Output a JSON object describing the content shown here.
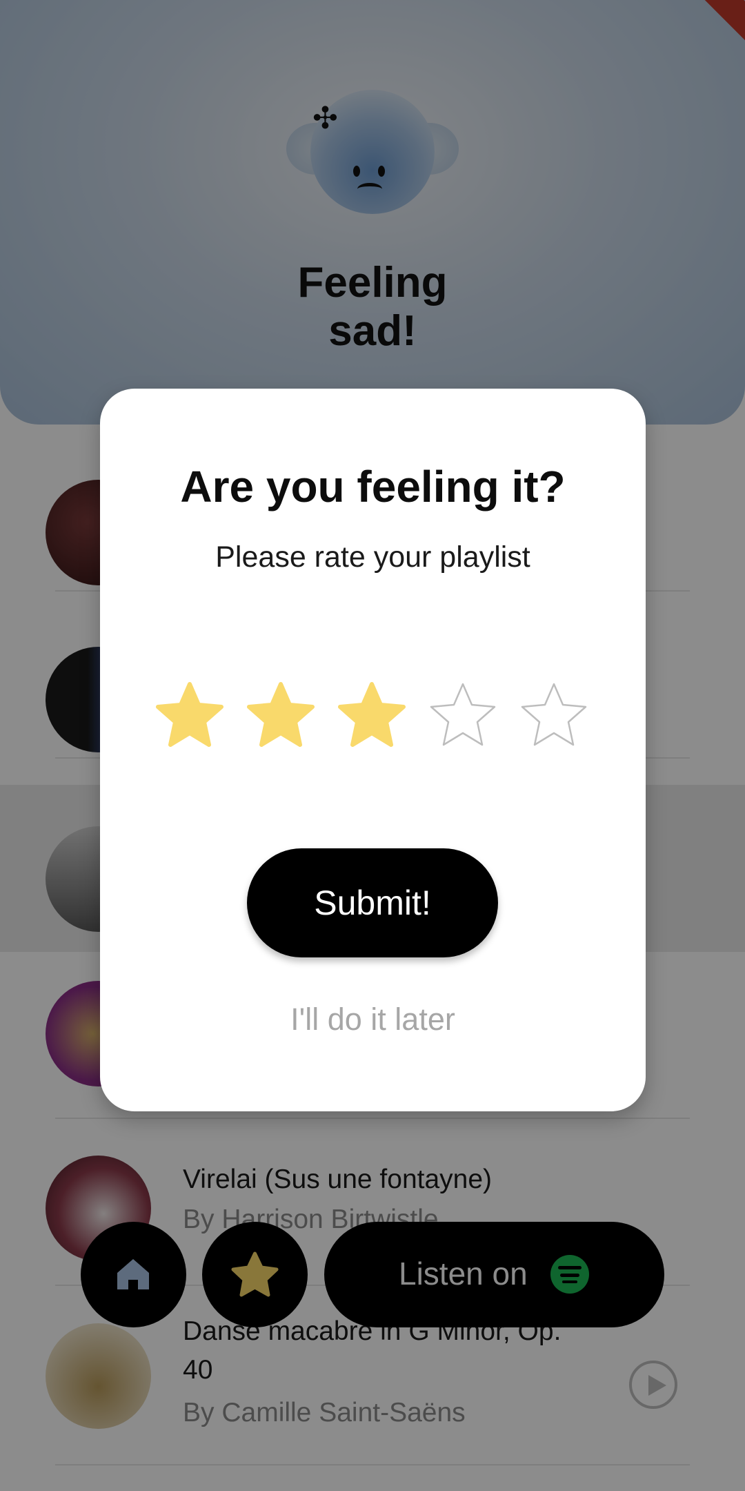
{
  "header": {
    "mood_title": "Feeling sad!",
    "mascot_mood": "sad"
  },
  "tracks": [
    {
      "title": "",
      "artist": "",
      "cover_color": "#5a2b2b"
    },
    {
      "title": "",
      "artist": "",
      "cover_color": "#2b3f6a"
    },
    {
      "title": "",
      "artist": "",
      "cover_color": "#9a9a9a",
      "highlighted": true
    },
    {
      "title": "",
      "artist": "",
      "cover_color": "#7a3d80"
    },
    {
      "title": "Virelai (Sus une fontayne)",
      "artist": "By Harrison Birtwistle",
      "cover_color": "#8b3a4a"
    },
    {
      "title": "Danse macabre in G Minor, Op. 40",
      "artist": "By Camille Saint-Saëns",
      "cover_color": "#d8c69a"
    }
  ],
  "bottom_nav": {
    "home_icon": "home-icon",
    "star_icon": "star-icon",
    "listen_label": "Listen on",
    "listen_icon": "spotify-icon"
  },
  "dialog": {
    "title": "Are you feeling it?",
    "subtitle": "Please rate your playlist",
    "rating": 3,
    "max_rating": 5,
    "submit_label": "Submit!",
    "later_label": "I'll do it later"
  },
  "colors": {
    "star_filled": "#f9d96b",
    "star_empty_stroke": "#bdbdbd",
    "scrim": "rgba(0,0,0,0.45)",
    "spotify_green": "#1db954"
  }
}
